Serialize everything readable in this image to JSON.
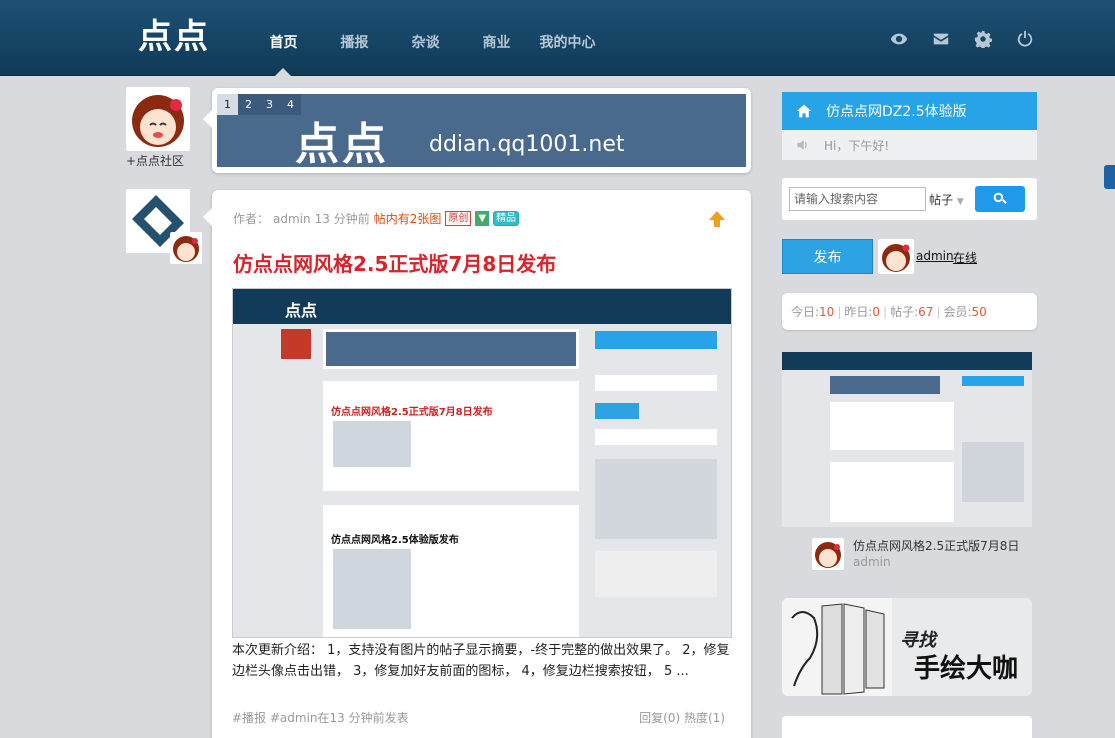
{
  "header": {
    "logo": "点点",
    "nav": [
      {
        "label": "首页",
        "active": true
      },
      {
        "label": "播报"
      },
      {
        "label": "杂谈"
      },
      {
        "label": "商业"
      },
      {
        "label": "我的中心"
      }
    ],
    "icons": [
      "eye-icon",
      "mail-icon",
      "gear-icon",
      "power-icon"
    ]
  },
  "community": {
    "label": "+点点社区"
  },
  "banner": {
    "tabs": [
      "1",
      "2",
      "3",
      "4"
    ],
    "logo": "点点",
    "url": "ddian.qq1001.net"
  },
  "post": {
    "meta_prefix": "作者：",
    "author": "admin",
    "time": "13 分钟前",
    "image_note": "帖内有2张图",
    "badge_original": "原创",
    "badge_featured": "精品",
    "title": "仿点点网风格2.5正式版7月8日发布",
    "body": "本次更新介绍： 1，支持没有图片的帖子显示摘要，-终于完整的做出效果了。 2，修复边栏头像点击出错， 3，修复加好友前面的图标， 4，修复边栏搜索按钮， 5 ...",
    "tags": "#播报  #admin在13 分钟前发表",
    "replies": "回复(0)",
    "heat": "热度(1)"
  },
  "sidebar": {
    "header": "仿点点网DZ2.5体验版",
    "greeting": "Hi，下午好!",
    "search": {
      "placeholder": "请输入搜索内容",
      "type": "帖子"
    },
    "publish": "发布",
    "user": {
      "name": "admin",
      "status": "在线"
    },
    "stats": [
      {
        "label": "今日:",
        "value": "10"
      },
      {
        "label": "昨日:",
        "value": "0"
      },
      {
        "label": "帖子:",
        "value": "67"
      },
      {
        "label": "会员:",
        "value": "50"
      }
    ],
    "recent_post": {
      "title": "仿点点网风格2.5正式版7月8日",
      "author": "admin"
    },
    "promo": {
      "line1": "寻找",
      "line2": "手绘大咖"
    }
  },
  "colors": {
    "header": "#143f5e",
    "accent": "#27a3e8",
    "title_red": "#d8232a",
    "number_orange": "#e0593a"
  }
}
